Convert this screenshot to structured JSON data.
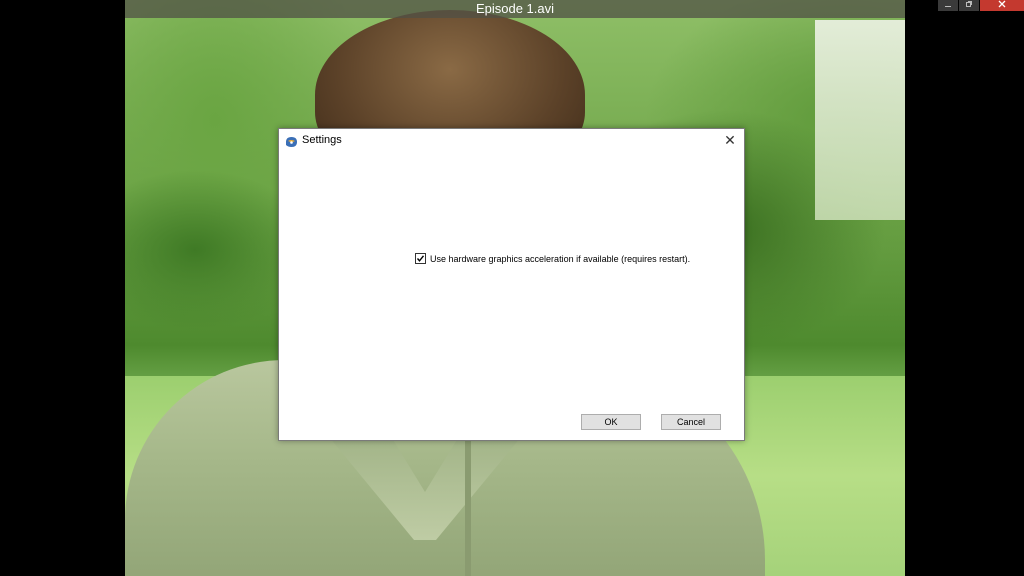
{
  "window": {
    "title": "Episode 1.avi",
    "controls": [
      "minimize-icon",
      "restore-icon",
      "close-icon"
    ]
  },
  "video": {
    "description_icon": "video-frame"
  },
  "dialog": {
    "title": "Settings",
    "icon": "app-icon",
    "close_icon": "close-icon",
    "close_glyph": "✕",
    "option": {
      "label": "Use hardware graphics acceleration if available (requires restart).",
      "checked": true
    },
    "ok_label": "OK",
    "cancel_label": "Cancel"
  },
  "colors": {
    "close_button": "#c4392f",
    "button_face": "#e1e1e1",
    "dialog_bg": "#ffffff"
  }
}
